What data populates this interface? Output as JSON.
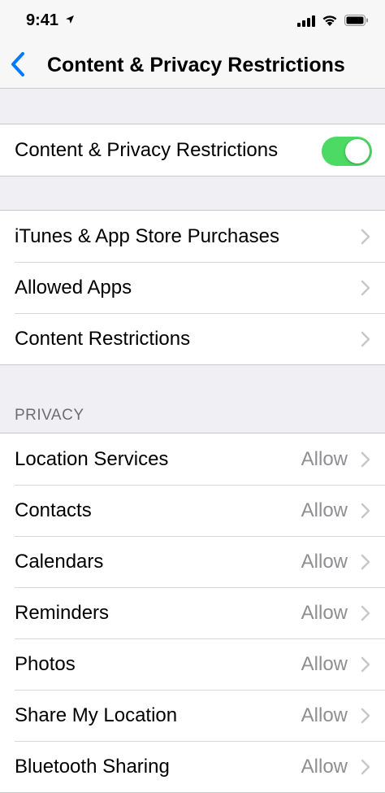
{
  "status_bar": {
    "time": "9:41"
  },
  "nav": {
    "title": "Content & Privacy Restrictions"
  },
  "master": {
    "label": "Content & Privacy Restrictions",
    "enabled": true
  },
  "store_group": [
    {
      "label": "iTunes & App Store Purchases"
    },
    {
      "label": "Allowed Apps"
    },
    {
      "label": "Content Restrictions"
    }
  ],
  "privacy": {
    "header": "PRIVACY",
    "items": [
      {
        "label": "Location Services",
        "value": "Allow"
      },
      {
        "label": "Contacts",
        "value": "Allow"
      },
      {
        "label": "Calendars",
        "value": "Allow"
      },
      {
        "label": "Reminders",
        "value": "Allow"
      },
      {
        "label": "Photos",
        "value": "Allow"
      },
      {
        "label": "Share My Location",
        "value": "Allow"
      },
      {
        "label": "Bluetooth Sharing",
        "value": "Allow"
      }
    ]
  },
  "colors": {
    "accent": "#007aff",
    "toggle_on": "#4cd964",
    "chevron": "#c7c7cc"
  },
  "icons": {
    "back": "chevron-left-icon",
    "disclosure": "chevron-right-icon",
    "location": "location-arrow-icon",
    "signal": "cellular-signal-icon",
    "wifi": "wifi-icon",
    "battery": "battery-icon"
  }
}
